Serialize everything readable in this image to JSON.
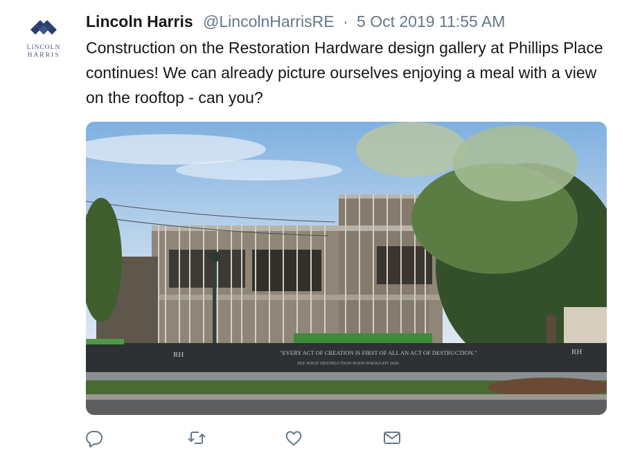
{
  "author": {
    "logo_line1": "LINCOLN",
    "logo_line2": "HARRIS",
    "name": "Lincoln Harris",
    "handle": "@LincolnHarrisRE",
    "separator": "·",
    "timestamp": "5 Oct 2019 11:55 AM"
  },
  "tweet": {
    "text": "Construction on the Restoration Hardware design gallery at Phillips Place continues! We can already picture ourselves enjoying a meal with a view on the rooftop - can you?"
  },
  "photo": {
    "banner_line1": "\"EVERY ACT OF CREATION IS FIRST OF ALL AN ACT OF DESTRUCTION.\"",
    "banner_line2": "SEE WHAT DESTRUCTION HATH WROUGHT 2020",
    "banner_logo": "RH"
  },
  "actions": {
    "reply_icon": "reply-icon",
    "retweet_icon": "retweet-icon",
    "like_icon": "heart-icon",
    "dm_icon": "envelope-icon"
  },
  "colors": {
    "text": "#14171a",
    "secondary": "#657786",
    "logo_blue": "#2a3f6e"
  }
}
